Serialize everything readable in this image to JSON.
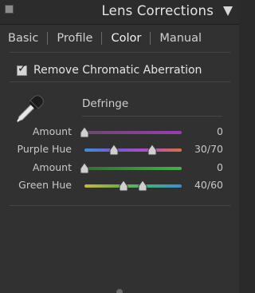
{
  "header": {
    "title": "Lens Corrections",
    "collapse_icon": "triangle-down-icon"
  },
  "tabs": [
    {
      "label": "Basic",
      "active": false
    },
    {
      "label": "Profile",
      "active": false
    },
    {
      "label": "Color",
      "active": true
    },
    {
      "label": "Manual",
      "active": false
    }
  ],
  "chromatic": {
    "label": "Remove Chromatic Aberration",
    "checked": true
  },
  "defringe": {
    "title": "Defringe",
    "eyedropper_icon": "eyedropper-icon",
    "rows": [
      {
        "label": "Amount",
        "value": "0",
        "positions": [
          0
        ],
        "gradient": [
          "#6a4a6a",
          "#9b3cb0"
        ]
      },
      {
        "label": "Purple Hue",
        "value": "30/70",
        "positions": [
          0.3,
          0.7
        ],
        "gradient": [
          "#3d8fd6",
          "#7b56d0",
          "#b050c0",
          "#d87040"
        ]
      },
      {
        "label": "Amount",
        "value": "0",
        "positions": [
          0
        ],
        "gradient": [
          "#3a6a3a",
          "#45b048"
        ]
      },
      {
        "label": "Green Hue",
        "value": "40/60",
        "positions": [
          0.4,
          0.6
        ],
        "gradient": [
          "#c9b840",
          "#78b040",
          "#3fb080",
          "#3c8fd0"
        ]
      }
    ]
  },
  "colors": {
    "panel_bg": "#313131",
    "header_bg": "#2c2c2c",
    "text": "#d6d6d6"
  }
}
